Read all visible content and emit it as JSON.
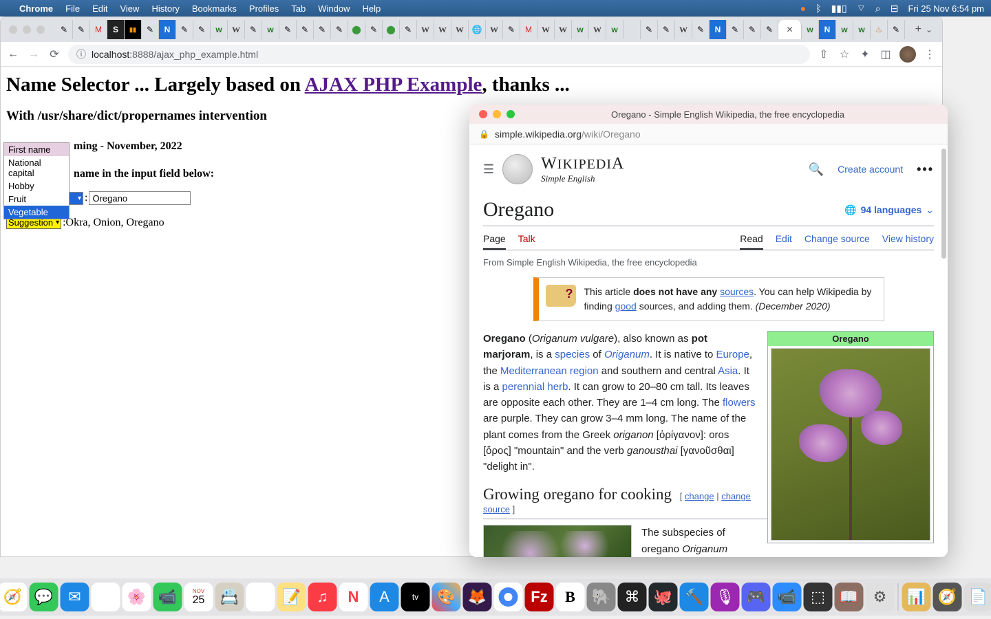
{
  "menubar": {
    "app": "Chrome",
    "items": [
      "File",
      "Edit",
      "View",
      "History",
      "Bookmarks",
      "Profiles",
      "Tab",
      "Window",
      "Help"
    ],
    "clock": "Fri 25 Nov  6:54 pm"
  },
  "chrome": {
    "url_host": "localhost",
    "url_port": ":8888",
    "url_path": "/ajax_php_example.html"
  },
  "page": {
    "h1_pre": "Name Selector ... Largely based on ",
    "h1_link": "AJAX PHP Example",
    "h1_post": ", thanks ...",
    "h2": "With /usr/share/dict/propernames intervention",
    "byline": "ming - November, 2022",
    "instruction": "name in the input field below:",
    "select_options": [
      "First name",
      "National capital",
      "Hobby",
      "Fruit",
      "Vegetable"
    ],
    "select_value": "Vegetable",
    "input_value": "Oregano",
    "suggestion_label": "Suggestion",
    "suggestion_text": ":Okra, Onion, Oregano"
  },
  "safari": {
    "title": "Oregano - Simple English Wikipedia, the free encyclopedia",
    "url": "simple.wikipedia.org/wiki/Oregano",
    "wordmark": "WIKIPEDIA",
    "wordmark_sub": "Simple English",
    "create_account": "Create account",
    "article_title": "Oregano",
    "languages": "94 languages",
    "tabs_left": [
      "Page",
      "Talk"
    ],
    "tabs_right": [
      "Read",
      "Edit",
      "Change source",
      "View history"
    ],
    "from_line": "From Simple English Wikipedia, the free encyclopedia",
    "notice_pre": "This article ",
    "notice_bold": "does not have any ",
    "notice_link1": "sources",
    "notice_mid": ". You can help Wikipedia by finding ",
    "notice_link2": "good",
    "notice_post": " sources, and adding them. ",
    "notice_date": "(December 2020)",
    "infobox_title": "Oregano",
    "section_title": "Growing oregano for cooking",
    "edit_change": "change",
    "edit_source": "change source",
    "para2": "The subspecies of oregano Origanum vulgare hirtum is an important herb. It is"
  }
}
